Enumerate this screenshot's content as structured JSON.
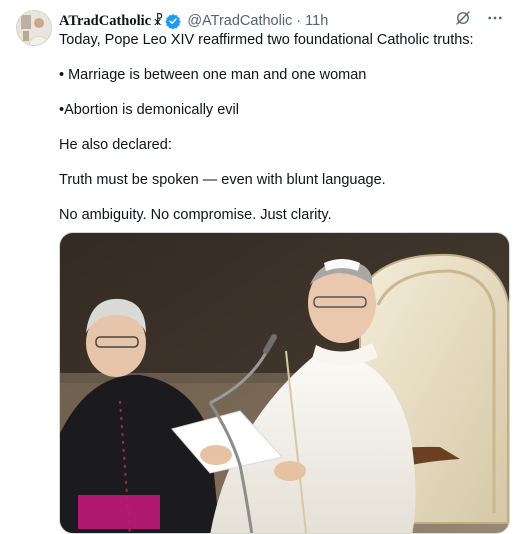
{
  "author": {
    "display_name": "ATradCatholic",
    "cross": "☧",
    "handle": "@ATradCatholic",
    "separator": "·",
    "time": "11h",
    "verified_color": "#1d9bf0"
  },
  "icons": {
    "grok": "grok-icon",
    "more": "more-icon",
    "verified": "verified-badge-icon"
  },
  "body": {
    "line1": "Today, Pope Leo XIV reaffirmed two foundational Catholic truths:",
    "line2": "• Marriage is between one man and one woman",
    "line3": "•Abortion is demonically evil",
    "line4": "He also declared:",
    "line5": "Truth must be spoken — even with blunt language.",
    "line6": "No ambiguity. No compromise. Just clarity."
  },
  "colors": {
    "text": "#0f1419",
    "secondary": "#536471",
    "border": "#cfd9de"
  }
}
